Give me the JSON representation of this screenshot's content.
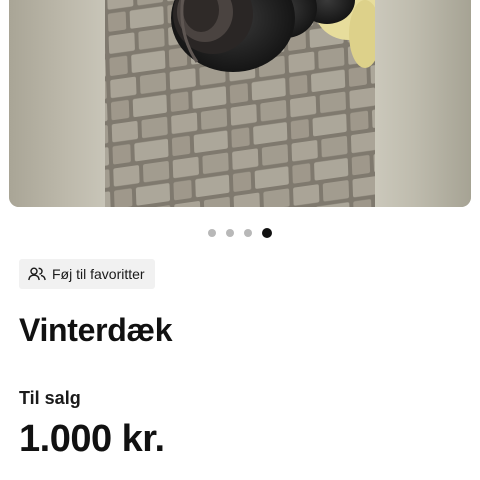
{
  "gallery": {
    "image_alt": "",
    "active_index": 3,
    "dots": [
      "",
      "",
      "",
      ""
    ]
  },
  "favorite": {
    "icon": "people-icon",
    "label": "Føj til favoritter"
  },
  "listing": {
    "title": "Vinterdæk",
    "sale_type": "Til salg",
    "price": "1.000 kr."
  },
  "colors": {
    "text": "#111111",
    "button_bg": "#f1f1f1",
    "dot_inactive": "#b8b8b8",
    "dot_active": "#111111"
  }
}
